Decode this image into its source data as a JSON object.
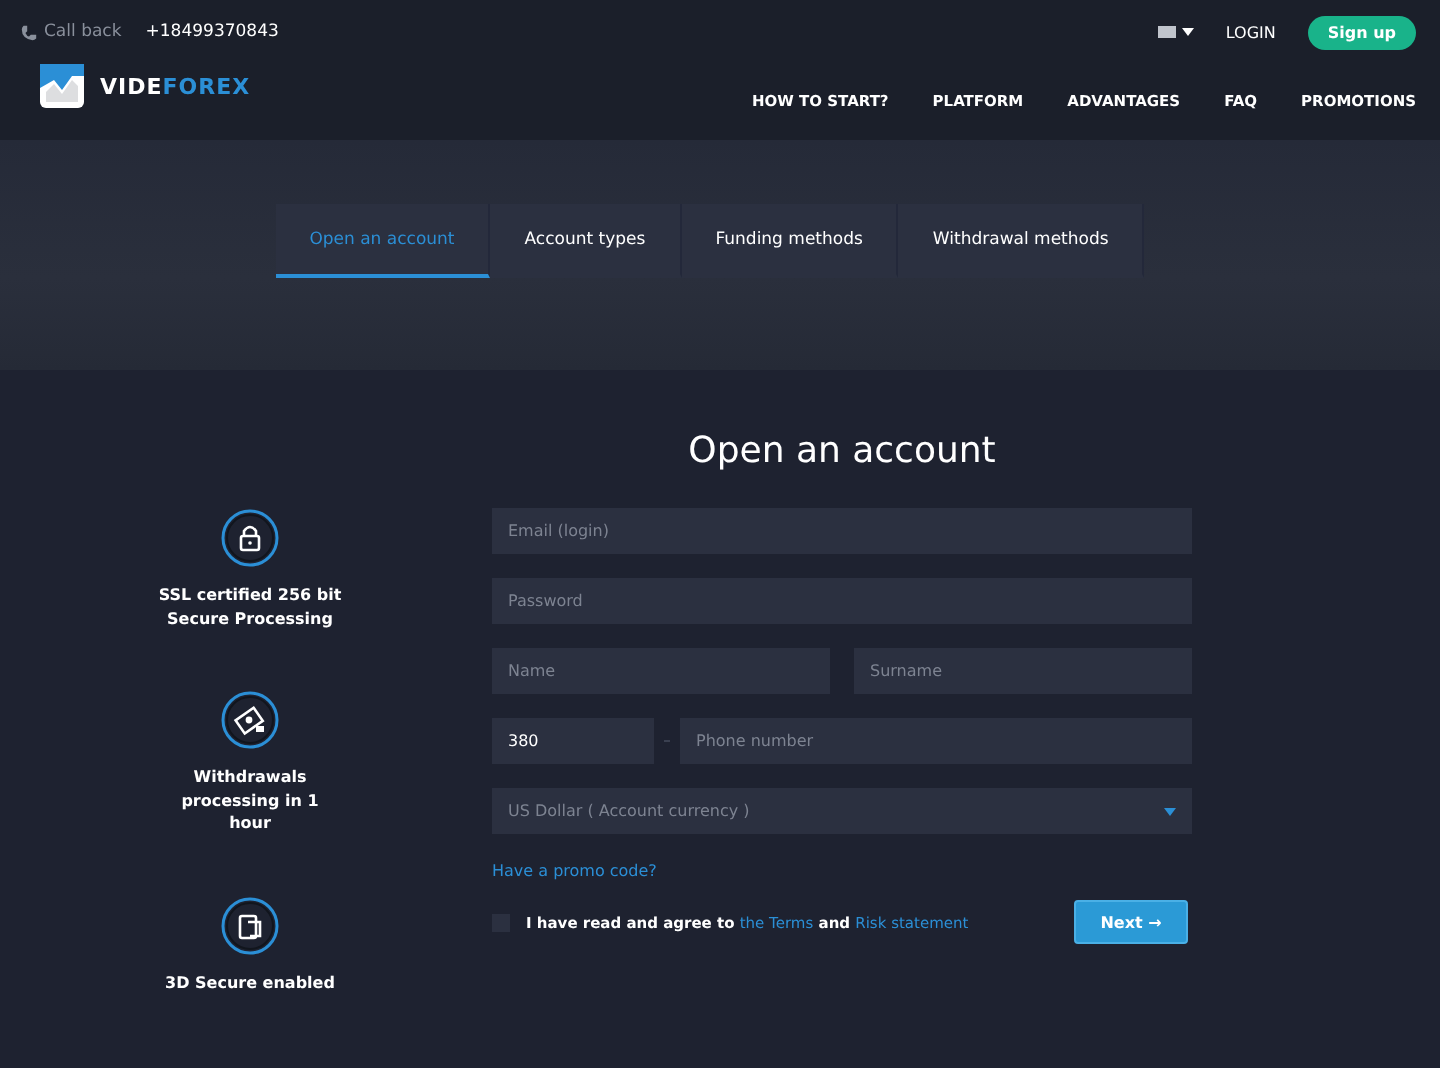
{
  "topbar": {
    "callback": "Call back",
    "phone": "+18499370843",
    "login": "LOGIN",
    "signup": "Sign up"
  },
  "logo": {
    "part1": "VIDE",
    "part2": "FOREX"
  },
  "nav": [
    "HOW TO START?",
    "PLATFORM",
    "ADVANTAGES",
    "FAQ",
    "PROMOTIONS"
  ],
  "tabs": [
    {
      "label": "Open an account",
      "selected": true
    },
    {
      "label": "Account types",
      "selected": false
    },
    {
      "label": "Funding methods",
      "selected": false
    },
    {
      "label": "Withdrawal methods",
      "selected": false
    }
  ],
  "title": "Open an account",
  "features": [
    {
      "kind": "lock",
      "text": "SSL certified 256 bit Secure Processing"
    },
    {
      "kind": "money",
      "text": "Withdrawals processing in 1 hour"
    },
    {
      "kind": "card",
      "text": "3D Secure enabled"
    }
  ],
  "form": {
    "email": {
      "placeholder": "Email (login)"
    },
    "password": {
      "placeholder": "Password"
    },
    "name": {
      "placeholder": "Name"
    },
    "surname": {
      "placeholder": "Surname"
    },
    "code": {
      "value": "380"
    },
    "phone": {
      "placeholder": "Phone number"
    },
    "currency": {
      "value": "US Dollar ( Account currency )"
    },
    "promo": "Have a promo code?",
    "agree": {
      "checked": false,
      "text": "I have read and agree to",
      "terms": "the Terms",
      "and": "and",
      "risk": "Risk statement"
    },
    "next": "Next",
    "next_arrow": "→"
  }
}
